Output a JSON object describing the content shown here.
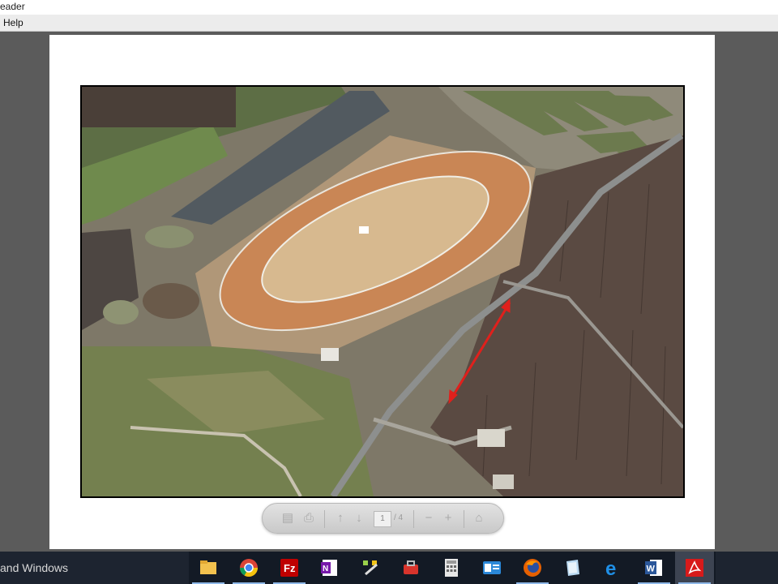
{
  "window": {
    "title": "eader"
  },
  "menubar": {
    "items": [
      {
        "label": "Help"
      }
    ]
  },
  "document_toolbar": {
    "current_page": "1",
    "total_pages": "/ 4"
  },
  "taskbar": {
    "search_text": "and Windows",
    "apps": [
      {
        "name": "file-explorer-icon",
        "active": false,
        "running": true
      },
      {
        "name": "chrome-icon",
        "active": false,
        "running": true
      },
      {
        "name": "filezilla-icon",
        "active": false,
        "running": true
      },
      {
        "name": "onenote-icon",
        "active": false,
        "running": false
      },
      {
        "name": "tools-icon",
        "active": false,
        "running": false
      },
      {
        "name": "toolbox-icon",
        "active": false,
        "running": false
      },
      {
        "name": "calculator-icon",
        "active": false,
        "running": false
      },
      {
        "name": "contact-card-icon",
        "active": false,
        "running": false
      },
      {
        "name": "firefox-icon",
        "active": false,
        "running": true
      },
      {
        "name": "notepad-icon",
        "active": false,
        "running": false
      },
      {
        "name": "edge-icon",
        "active": false,
        "running": false
      },
      {
        "name": "word-icon",
        "active": false,
        "running": true
      },
      {
        "name": "acrobat-icon",
        "active": true,
        "running": true
      }
    ]
  },
  "colors": {
    "accent_arrow": "#e0201c",
    "track_dirt": "#c98655",
    "taskbar": "#1d2430"
  }
}
